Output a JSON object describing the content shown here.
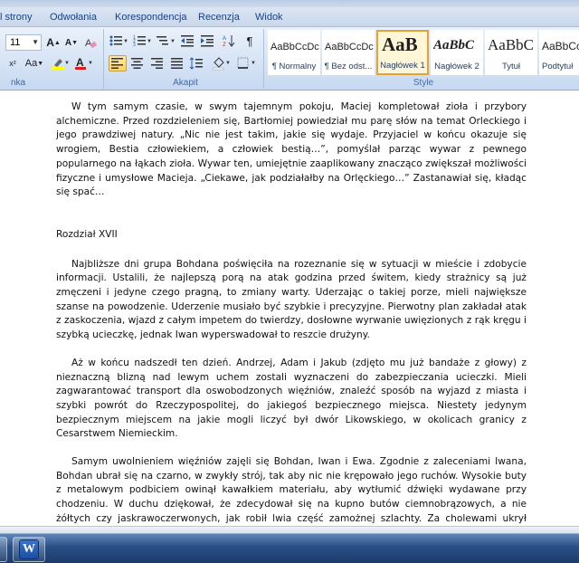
{
  "ribbon_tabs": [
    "l strony",
    "Odwołania",
    "Korespondencja",
    "Recenzja",
    "Widok"
  ],
  "font": {
    "size": "11"
  },
  "groups": {
    "font_label": "nka",
    "paragraph_label": "Akapit",
    "styles_label": "Style"
  },
  "styles": [
    {
      "sample": "AaBbCcDc",
      "name": "¶ Normalny"
    },
    {
      "sample": "AaBbCcDc",
      "name": "¶ Bez odst..."
    },
    {
      "sample": "AaB",
      "name": "Nagłówek 1"
    },
    {
      "sample": "AaBbC",
      "name": "Nagłówek 2"
    },
    {
      "sample": "AaBbC",
      "name": "Tytuł"
    },
    {
      "sample": "AaBbCc",
      "name": "Podtytuł"
    }
  ],
  "document": {
    "p1": "W tym samym czasie, w swym tajemnym pokoju, Maciej kompletował zioła i przybory alchemiczne.  Przed rozdzieleniem się, Bartłomiej powiedział mu parę słów na temat Orleckiego i jego prawdziwej natury. „Nic nie jest takim, jakie się wydaje. Przyjaciel w końcu okazuje się wrogiem, Bestia człowiekiem, a człowiek bestią…”, pomyślał parząc wywar z pewnego popularnego na łąkach zioła. Wywar ten, umiejętnie zaaplikowany znacząco zwiększał możliwości fizyczne i umysłowe Macieja. „Ciekawe, jak podziałałby na Orlęckiego…” Zastanawiał się, kładąc się spać…",
    "heading": "Rozdział XVII",
    "p2": "Najbliższe dni grupa Bohdana poświęciła na rozeznanie się w sytuacji w mieście i zdobycie informacji.  Ustalili, że najlepszą porą na atak godzina przed świtem, kiedy strażnicy są już zmęczeni i jedyne czego pragną, to zmiany warty. Uderzając o takiej porze, mieli największe szanse na powodzenie. Uderzenie musiało być szybkie i precyzyjne. Pierwotny plan zakładał atak z zaskoczenia, wjazd z całym impetem do twierdzy, dosłowne wyrwanie uwięzionych z rąk kręgu i szybką ucieczkę, jednak Iwan wyperswadował to reszcie drużyny.",
    "p3": "Aż w końcu nadszedł ten dzień. Andrzej, Adam i Jakub (zdjęto mu już bandaże z głowy) z nieznaczną blizną nad lewym uchem zostali wyznaczeni do zabezpieczania ucieczki. Mieli zagwarantować transport dla oswobodzonych więźniów, znaleźć sposób na wyjazd z miasta i szybki powrót do Rzeczypospolitej, do jakiegoś bezpiecznego miejsca. Niestety jedynym bezpiecznym miejscem na jakie mogli liczyć był dwór Likowskiego, w okolicach  granicy z Cesarstwem Niemieckim.",
    "p4": "Samym uwolnieniem więźniów zajęli się Bohdan, Iwan i Ewa. Zgodnie z zaleceniami Iwana, Bohdan ubrał się na czarno, w zwykły strój, tak aby nic nie krępowało jego ruchów. Wysokie buty z metalowym podbiciem owinął kawałkiem materiału, aby wytłumić dźwięki wydawane przy chodzeniu. W duchu dziękował, że zdecydował się na kupno butów ciemnobrązowych, a nie żółtych czy jaskrawoczerwonych, jak robił lwia część zamożnej szlachty. Za cholewami ukrył sztylety, a do pasa przytroczył szablę. Szabla jego zwana pałaszem krzywym, łączyła w sobie najlepsze cechy szabel zachodnioeuropejskich, tureckich i madziarskich. Bohdan był z niej dumny. Naprawdę wiele za nią zapłacił,  ale był to wydatek uzasadniony. Wielu znanych mu płatnerzy uważało czarną szablę za"
  }
}
